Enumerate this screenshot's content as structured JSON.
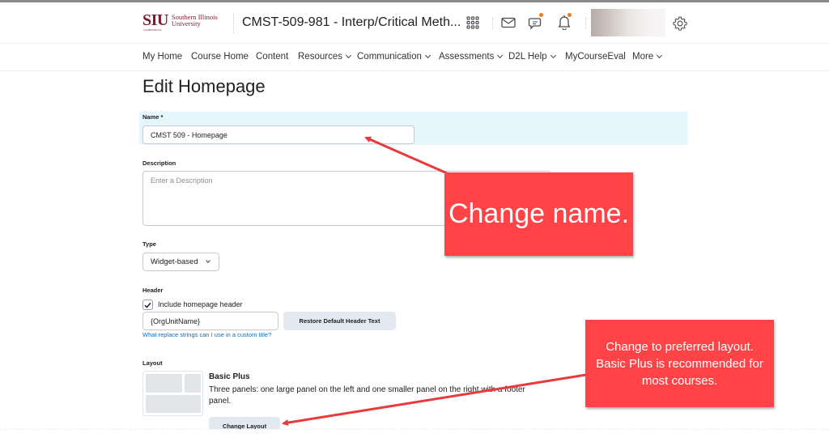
{
  "header": {
    "logo": {
      "abbr": "SIU",
      "name_line1": "Southern Illinois",
      "name_line2": "University",
      "campus": "CARBONDALE"
    },
    "course_title": "CMST-509-981 - Interp/Critical Meth...",
    "icons": [
      "apps-grid-icon",
      "mail-icon",
      "chat-icon",
      "bell-icon",
      "gear-icon"
    ],
    "notification_color": "#f57c14"
  },
  "nav": {
    "items": [
      {
        "label": "My Home",
        "dropdown": false
      },
      {
        "label": "Course Home",
        "dropdown": false
      },
      {
        "label": "Content",
        "dropdown": false
      },
      {
        "label": "Resources",
        "dropdown": true
      },
      {
        "label": "Communication",
        "dropdown": true
      },
      {
        "label": "Assessments",
        "dropdown": true
      },
      {
        "label": "D2L Help",
        "dropdown": true
      },
      {
        "label": "MyCourseEval",
        "dropdown": false
      },
      {
        "label": "More",
        "dropdown": true
      }
    ]
  },
  "page": {
    "title": "Edit Homepage",
    "name": {
      "label": "Name *",
      "value": "CMST 509 - Homepage"
    },
    "description": {
      "label": "Description",
      "placeholder": "Enter a Description"
    },
    "type": {
      "label": "Type",
      "selected": "Widget-based"
    },
    "header_section": {
      "label": "Header",
      "checkbox_label": "Include homepage header",
      "checked": true,
      "header_text_value": "{OrgUnitName}",
      "restore_button": "Restore Default Header Text",
      "help_link": "What replace strings can I use in a custom title?"
    },
    "layout": {
      "label": "Layout",
      "name": "Basic Plus",
      "description": "Three panels: one large panel on the left and one smaller panel on the right with a footer panel.",
      "change_button": "Change Layout"
    }
  },
  "annotations": {
    "callout_name": "Change name.",
    "callout_layout": "Change to preferred layout. Basic Plus is recommended for most courses.",
    "callout_color": "#ff4347"
  }
}
